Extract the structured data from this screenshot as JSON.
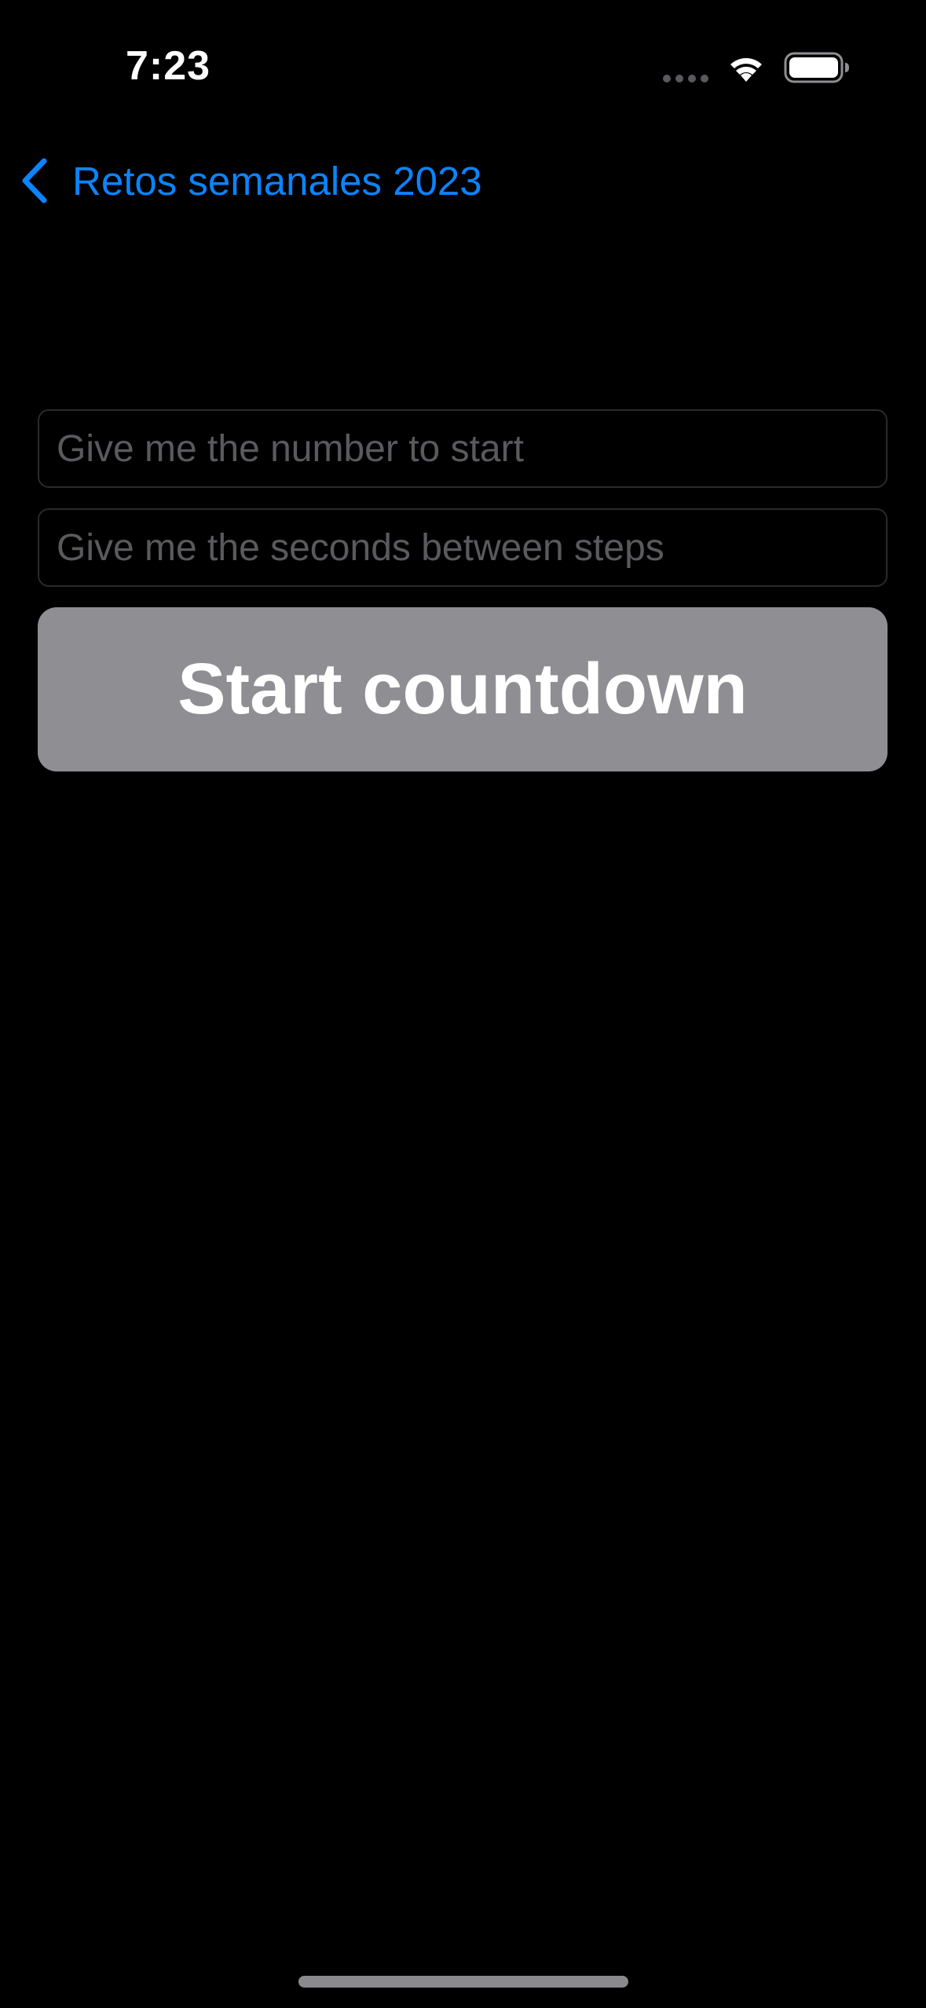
{
  "status_bar": {
    "time": "7:23",
    "icons": [
      "cellular-signal-icon",
      "wifi-icon",
      "battery-icon"
    ]
  },
  "nav": {
    "back_label": "Retos semanales 2023",
    "back_icon": "chevron-left-icon"
  },
  "form": {
    "number_placeholder": "Give me the number to start",
    "number_value": "",
    "seconds_placeholder": "Give me the seconds between steps",
    "seconds_value": "",
    "start_label": "Start countdown"
  },
  "colors": {
    "background": "#000000",
    "accent": "#0a84ff",
    "button_background": "#8e8e93",
    "button_text": "#ffffff",
    "placeholder": "#5a5a5e"
  }
}
